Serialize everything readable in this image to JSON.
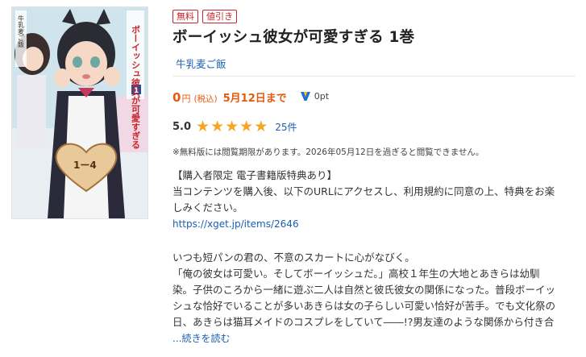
{
  "cover": {
    "alt": "Book cover",
    "title_vertical": "ボーイッシュ彼女が可愛すぎる",
    "volume": "1",
    "author": "牛乳麦ご飯",
    "badge_text": "1ー4",
    "colors": {
      "bg": "#cfe4ec",
      "dress": "#2a2a3a",
      "apron": "#f5f5f5",
      "hair": "#2b2b33",
      "skin": "#f6d8c6",
      "heart": "#e9c99a"
    }
  },
  "badges": [
    "無料",
    "値引き"
  ],
  "title": "ボーイッシュ彼女が可愛すぎる 1巻",
  "author": "牛乳麦ご飯",
  "price": {
    "amount": "0",
    "unit": "円",
    "tax": "(税込)",
    "deadline": "5月12日まで",
    "points": "0pt",
    "points_icon": "v-point-icon"
  },
  "rating": {
    "value": "5.0",
    "stars": 5,
    "count": "25件"
  },
  "notice": "※無料版には閲覧期限があります。2026年05月12日を過ぎると閲覧できません。",
  "description": {
    "bonus_heading": "【購入者限定 電子書籍版特典あり】",
    "bonus_lines": [
      "当コンテンツを購入後、以下のURLにアクセスし、利用規約に同意の上、特典をお楽",
      "しみください。"
    ],
    "url": "https://xget.jp/items/2646",
    "synopsis_lines": [
      "いつも短パンの君の、不意のスカートに心がなびく。",
      "「俺の彼女は可愛い。そしてボーイッシュだ。」高校１年生の大地とあきらは幼馴",
      "染。子供のころから一緒に遊ぶ二人は自然と彼氏彼女の関係になった。普段ボーイッ",
      "シュな恰好でいることが多いあきらは女の子らしい可愛い恰好が苦手。でも文化祭の",
      "日、あきらは猫耳メイドのコスプレをしていて――!?男友達のような関係から付き合"
    ],
    "read_more": "...続きを読む"
  },
  "colors": {
    "accent": "#e8590c",
    "badge": "#c8262b",
    "link": "#1a5fb4",
    "star": "#f5a623"
  }
}
